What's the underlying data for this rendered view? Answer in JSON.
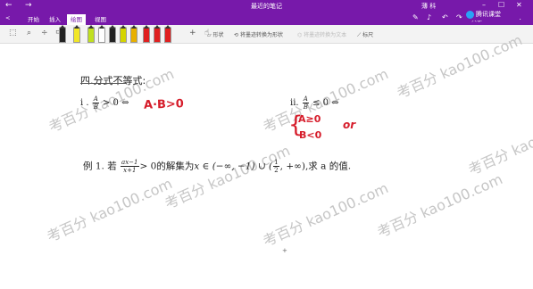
{
  "window": {
    "title": "最近的笔记",
    "user": "薄 科",
    "nav_back": "←",
    "nav_forward": "→"
  },
  "tabs": {
    "back_icon": "<",
    "items": [
      "开始",
      "插入",
      "绘图",
      "视图"
    ],
    "active": "绘图",
    "share_label": "共享"
  },
  "toolbar": {
    "shape_label": "形状",
    "ink_to_shape_label": "将墨迹转换为形状",
    "ink_to_text_label": "将墨迹转换为文本",
    "ruler_label": "标尺",
    "pen_colors": [
      "#222222",
      "#f0e628",
      "#c0e020",
      "#ffffff",
      "#222222",
      "#d4d400",
      "#e8b000",
      "#e02020",
      "#e02020",
      "#e02020"
    ]
  },
  "overlay": {
    "brand": "腾讯课堂"
  },
  "note": {
    "heading": "四.分式不等式:",
    "case1": {
      "label": "i .",
      "num": "A",
      "den": "B",
      "rel": "> 0 ⇔"
    },
    "case1_handwriting": "A·B>0",
    "case2": {
      "label": "ii.",
      "num": "A",
      "den": "B",
      "rel": "≤ 0 ⇔"
    },
    "case2_handwriting": {
      "line1": "A≥0",
      "line2": "B<0",
      "connector": "or"
    },
    "example": {
      "prefix": "例 1.  若",
      "num": "ax−1",
      "den": "x+1",
      "mid": "> 0的解集为",
      "set": "x ∈ (−∞, −1) ∪ (",
      "half_num": "1",
      "half_den": "2",
      "set_end": ", +∞)",
      "suffix": ",求 a 的值."
    }
  },
  "watermarks": [
    "考百分 kao100.com",
    "考百分 kao100.com",
    "考百分 kao100.com",
    "考百分 kao100.com",
    "考百分 kao100.com",
    "考百分 kao100.com",
    "考百分 kao100.com",
    "考百分 kao100.com"
  ]
}
